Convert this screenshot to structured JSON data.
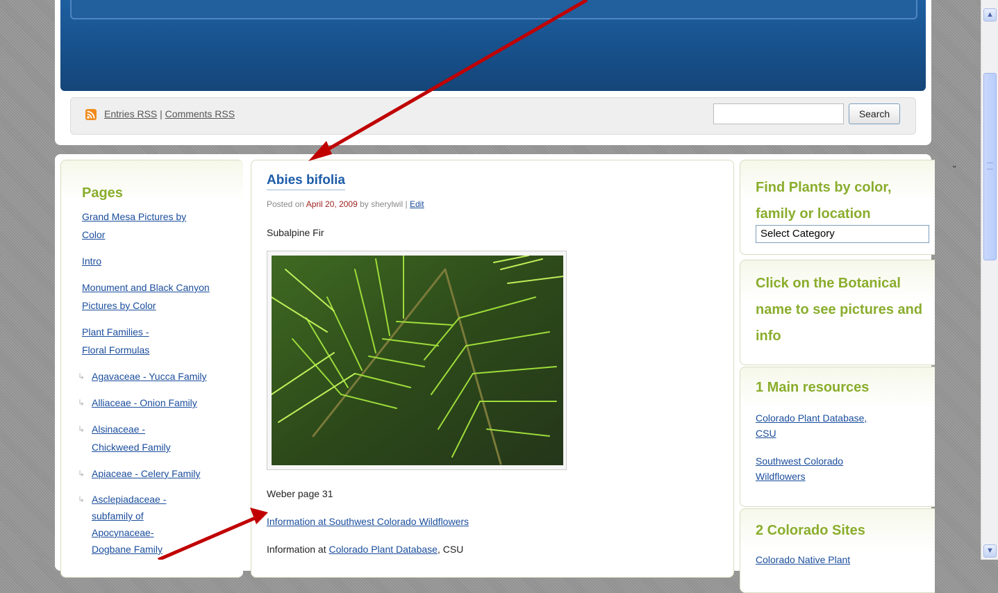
{
  "header": {
    "rss_entries": "Entries RSS",
    "rss_separator": "|",
    "rss_comments": "Comments RSS",
    "search_button": "Search"
  },
  "sidebar": {
    "title": "Pages",
    "pages": [
      {
        "label": "Grand Mesa Pictures by Color"
      },
      {
        "label": "Intro"
      },
      {
        "label": "Monument and Black Canyon Pictures by Color"
      },
      {
        "label": "Plant Families - Floral Formulas"
      }
    ],
    "subpages": [
      {
        "label": "Agavaceae - Yucca Family"
      },
      {
        "label": "Alliaceae - Onion Family"
      },
      {
        "label": "Alsinaceae - Chickweed Family"
      },
      {
        "label": "Apiaceae - Celery Family"
      },
      {
        "label": "Asclepiadaceae - subfamily of Apocynaceae- Dogbane Family"
      }
    ],
    "sub_arrow_glyph": "↳"
  },
  "post": {
    "title": "Abies bifolia",
    "meta_prefix": "Posted on",
    "date": "April 20, 2009",
    "meta_by": "by sherylwil |",
    "edit_label": "Edit",
    "subtitle": "Subalpine Fir",
    "weber": "Weber page 31",
    "info_link_1": "Information at Southwest Colorado Wildflowers",
    "info_2_prefix": "Information at",
    "info_2_link": "Colorado Plant Database",
    "info_2_suffix": ", CSU"
  },
  "right_sidebar": {
    "find_title": "Find Plants by color, family or location",
    "select_value": "Select Category",
    "click_title": "Click on the Botanical name to see pictures and info",
    "main_title": "1 Main resources",
    "main_links": [
      {
        "label": "Colorado Plant Database, CSU"
      },
      {
        "label": "Southwest Colorado Wildflowers"
      }
    ],
    "sites_title": "2 Colorado Sites",
    "sites_links": [
      {
        "label": "Colorado Native Plant"
      }
    ]
  },
  "scrollbar": {
    "up_glyph": "▲",
    "down_glyph": "▼"
  },
  "colors": {
    "link": "#1a4d9c",
    "widget_title": "#8aad2d",
    "banner": "#1e5fa0",
    "arrow": "#c00000"
  },
  "icons": [
    "rss-icon",
    "annotation-arrow"
  ]
}
